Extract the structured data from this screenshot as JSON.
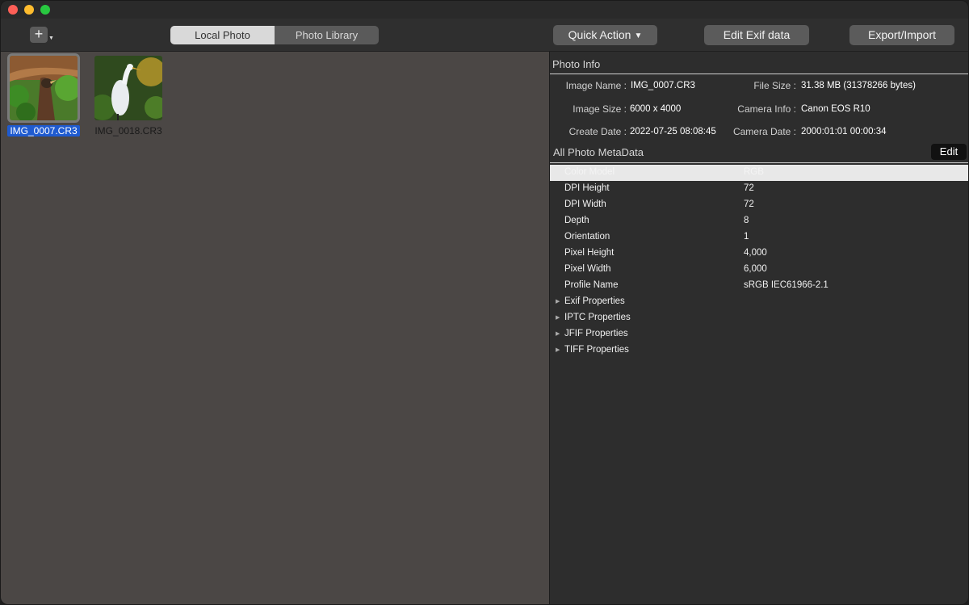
{
  "window": {
    "traffic_lights": [
      "close",
      "minimize",
      "zoom"
    ]
  },
  "toolbar": {
    "add_label": "+",
    "segments": [
      "Local Photo",
      "Photo Library"
    ],
    "active_segment": "Local Photo",
    "quick_action": "Quick Action",
    "edit_exif": "Edit Exif data",
    "export_import": "Export/Import"
  },
  "browser": {
    "photos": [
      {
        "name": "IMG_0007.CR3",
        "selected": true
      },
      {
        "name": "IMG_0018.CR3",
        "selected": false
      }
    ]
  },
  "photo_info": {
    "title": "Photo Info",
    "image_name_label": "Image Name :",
    "image_name": "IMG_0007.CR3",
    "file_size_label": "File Size :",
    "file_size": "31.38 MB (31378266 bytes)",
    "image_size_label": "Image Size :",
    "image_size": "6000 x 4000",
    "camera_info_label": "Camera Info :",
    "camera_info": "Canon EOS R10",
    "create_date_label": "Create Date :",
    "create_date": "2022-07-25 08:08:45",
    "camera_date_label": "Camera Date :",
    "camera_date": "2000:01:01 00:00:34"
  },
  "metadata": {
    "title": "All Photo MetaData",
    "edit_label": "Edit",
    "rows": [
      {
        "key": "Color Model",
        "value": "RGB"
      },
      {
        "key": "DPI Height",
        "value": "72"
      },
      {
        "key": "DPI Width",
        "value": "72"
      },
      {
        "key": "Depth",
        "value": "8"
      },
      {
        "key": "Orientation",
        "value": "1"
      },
      {
        "key": "Pixel Height",
        "value": "4,000"
      },
      {
        "key": "Pixel Width",
        "value": "6,000"
      },
      {
        "key": "Profile Name",
        "value": "sRGB IEC61966-2.1"
      }
    ],
    "groups": [
      "Exif Properties",
      "IPTC Properties",
      "JFIF Properties",
      "TIFF Properties"
    ]
  }
}
